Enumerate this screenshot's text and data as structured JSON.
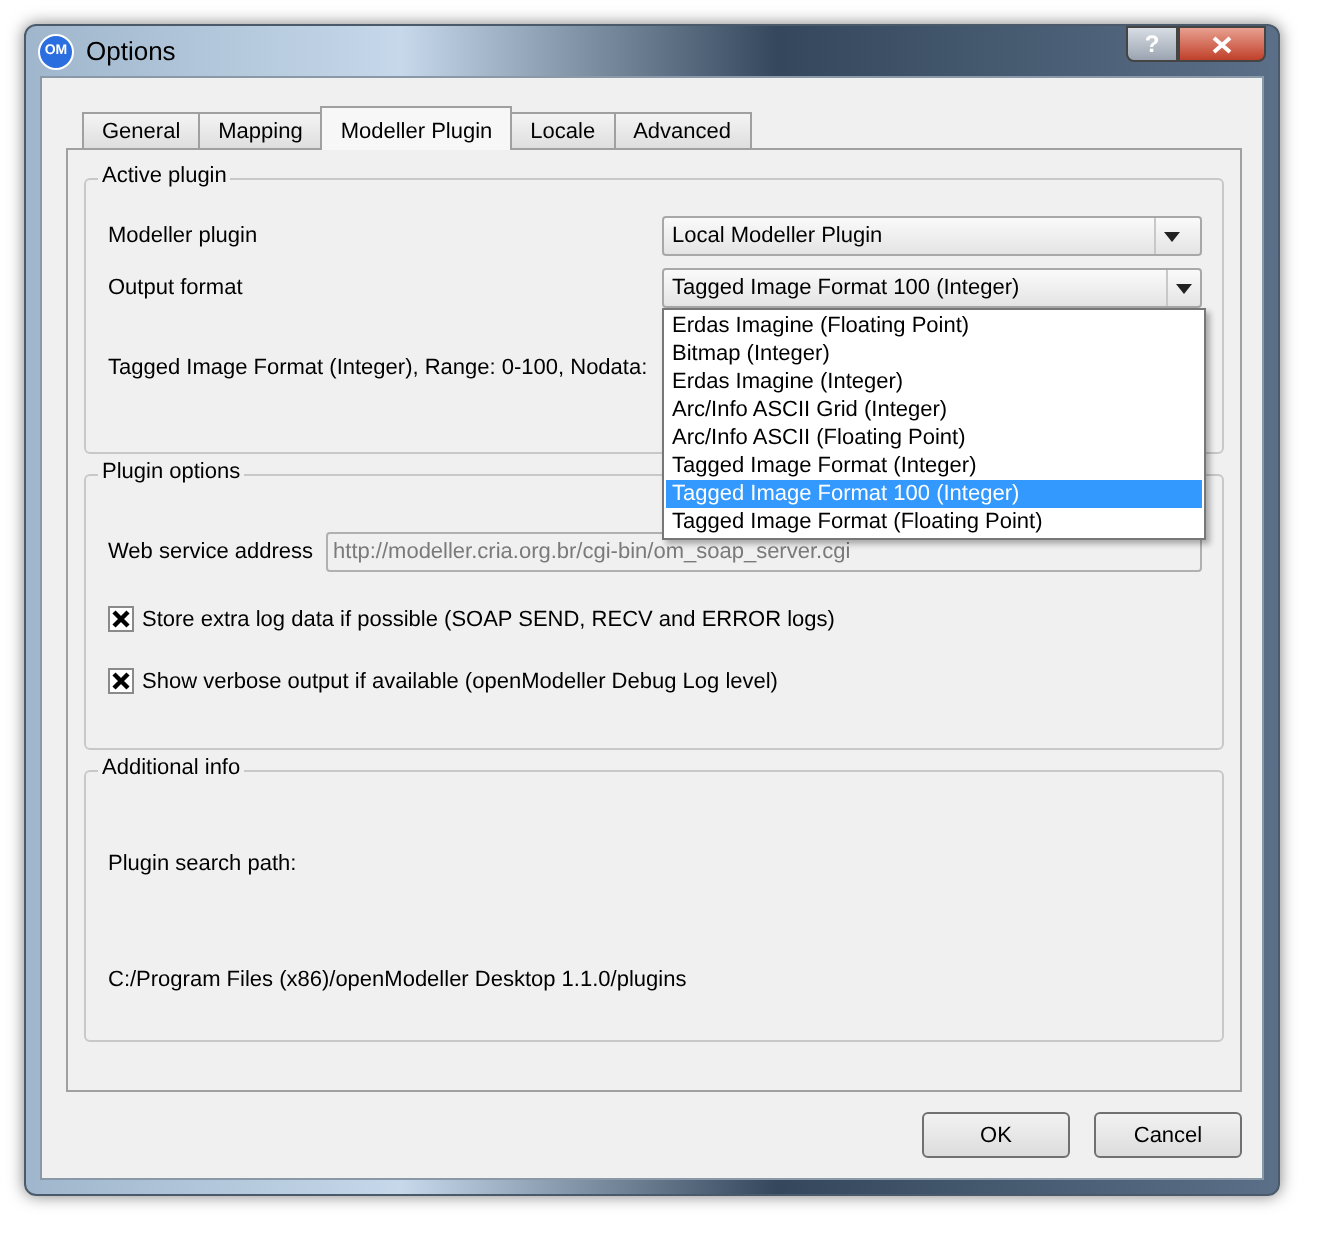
{
  "window": {
    "icon_label": "OM",
    "title": "Options",
    "help_label": "?"
  },
  "tabs": [
    {
      "label": "General",
      "selected": false
    },
    {
      "label": "Mapping",
      "selected": false
    },
    {
      "label": "Modeller Plugin",
      "selected": true
    },
    {
      "label": "Locale",
      "selected": false
    },
    {
      "label": "Advanced",
      "selected": false
    }
  ],
  "active_plugin": {
    "title": "Active plugin",
    "modeller_plugin": {
      "label": "Modeller plugin",
      "value": "Local Modeller Plugin"
    },
    "output_format": {
      "label": "Output format",
      "value": "Tagged Image Format 100 (Integer)",
      "expanded": true,
      "options": [
        {
          "label": "Erdas Imagine (Floating Point)",
          "selected": false
        },
        {
          "label": "Bitmap (Integer)",
          "selected": false
        },
        {
          "label": "Erdas Imagine (Integer)",
          "selected": false
        },
        {
          "label": "Arc/Info ASCII Grid (Integer)",
          "selected": false
        },
        {
          "label": "Arc/Info ASCII (Floating Point)",
          "selected": false
        },
        {
          "label": "Tagged Image Format (Integer)",
          "selected": false
        },
        {
          "label": "Tagged Image Format 100 (Integer)",
          "selected": true
        },
        {
          "label": "Tagged Image Format (Floating Point)",
          "selected": false
        }
      ]
    },
    "description": "Tagged Image Format (Integer), Range: 0-100, Nodata:"
  },
  "plugin_options": {
    "title": "Plugin options",
    "web_service": {
      "label": "Web service address",
      "value": "http://modeller.cria.org.br/cgi-bin/om_soap_server.cgi",
      "disabled": true
    },
    "checkboxes": [
      {
        "label": "Store extra log data if possible (SOAP SEND, RECV and ERROR logs)",
        "checked": true
      },
      {
        "label": "Show verbose output if available (openModeller Debug Log level)",
        "checked": true
      }
    ]
  },
  "additional_info": {
    "title": "Additional info",
    "search_path_label": "Plugin search path:",
    "search_path": "C:/Program Files (x86)/openModeller Desktop 1.1.0/plugins"
  },
  "buttons": [
    "OK",
    "Cancel"
  ]
}
